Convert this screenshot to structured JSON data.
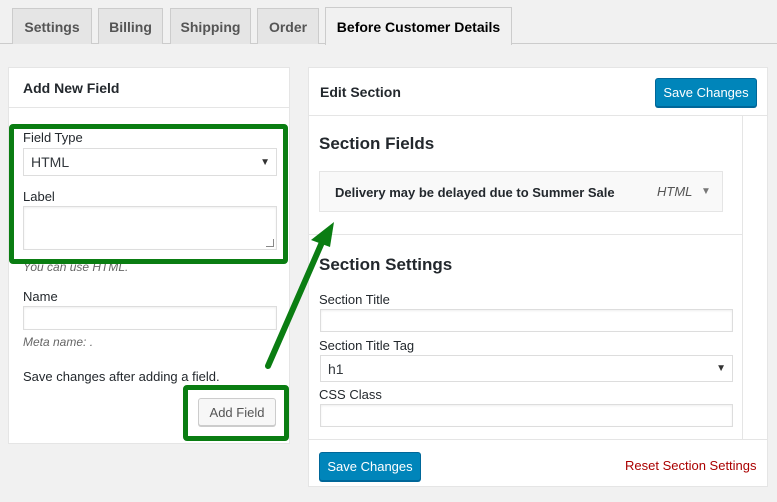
{
  "tabs": [
    {
      "label": "Settings"
    },
    {
      "label": "Billing"
    },
    {
      "label": "Shipping"
    },
    {
      "label": "Order"
    },
    {
      "label": "Before Customer Details",
      "active": true
    }
  ],
  "add_field": {
    "title": "Add New Field",
    "field_type_label": "Field Type",
    "field_type_value": "HTML",
    "label_label": "Label",
    "label_hint": "You can use HTML.",
    "name_label": "Name",
    "meta_hint": "Meta name: .",
    "save_note": "Save changes after adding a field.",
    "add_button": "Add Field"
  },
  "edit_section": {
    "title": "Edit Section",
    "save_top": "Save Changes",
    "fields_heading": "Section Fields",
    "fields": [
      {
        "name": "Delivery may be delayed due to Summer Sale",
        "type": "HTML"
      }
    ],
    "settings_heading": "Section Settings",
    "section_title_label": "Section Title",
    "section_title_tag_label": "Section Title Tag",
    "section_title_tag_value": "h1",
    "css_class_label": "CSS Class",
    "save_bottom": "Save Changes",
    "reset_link": "Reset Section Settings"
  },
  "colors": {
    "highlight": "#0a7d12",
    "primary_button": "#0085ba",
    "reset_link": "#aa0000"
  },
  "icons": [
    "select-arrow-icon",
    "toggle-arrow-icon",
    "annotation-arrow-icon"
  ]
}
